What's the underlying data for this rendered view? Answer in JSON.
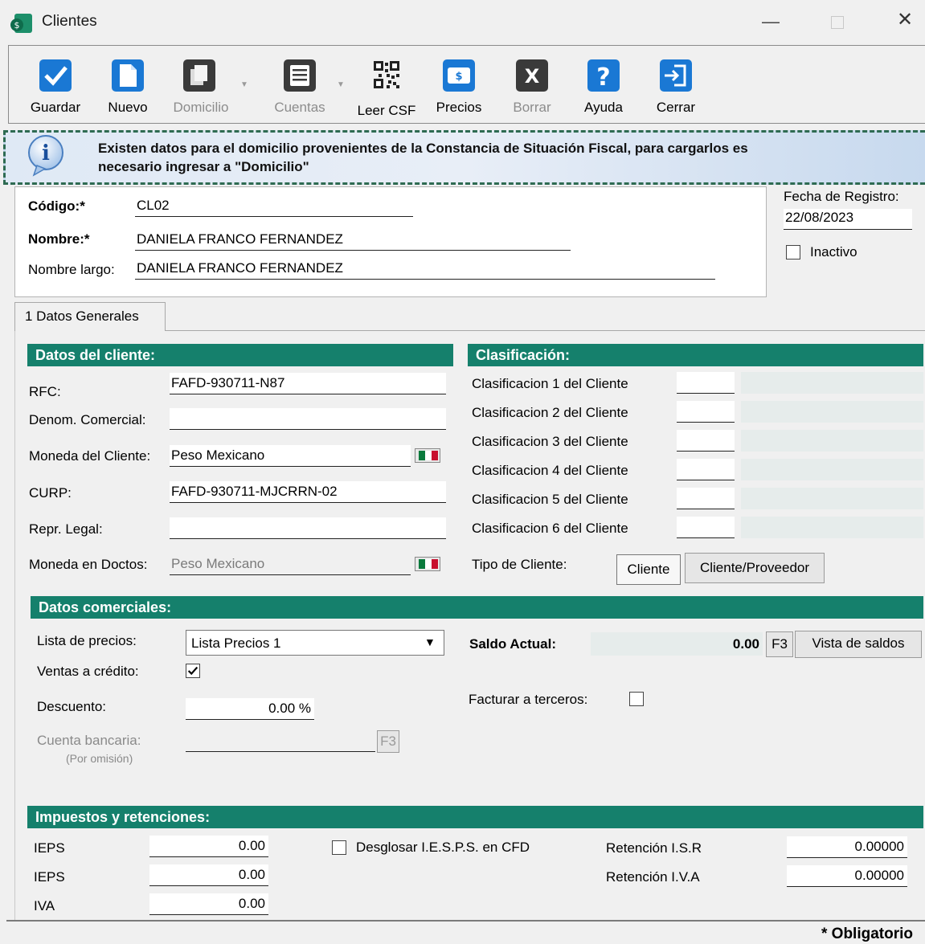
{
  "window": {
    "title": "Clientes"
  },
  "toolbar": {
    "guardar": "Guardar",
    "nuevo": "Nuevo",
    "domicilio": "Domicilio",
    "cuentas": "Cuentas",
    "leer_csf": "Leer CSF",
    "precios": "Precios",
    "borrar": "Borrar",
    "ayuda": "Ayuda",
    "cerrar": "Cerrar"
  },
  "info": {
    "line1": "Existen datos para el domicilio provenientes de la Constancia de Situación Fiscal, para cargarlos es",
    "line2": "necesario ingresar a \"Domicilio\""
  },
  "header": {
    "codigo_label": "Código:*",
    "codigo_value": "CL02",
    "nombre_label": "Nombre:*",
    "nombre_value": "DANIELA FRANCO FERNANDEZ",
    "nombre_largo_label": "Nombre largo:",
    "nombre_largo_value": "DANIELA FRANCO FERNANDEZ",
    "fecha_label": "Fecha de Registro:",
    "fecha_value": "22/08/2023",
    "inactivo_label": "Inactivo"
  },
  "tabs": [
    {
      "label": "1 Datos Generales"
    }
  ],
  "datos_cliente": {
    "title": "Datos del cliente:",
    "rfc_label": "RFC:",
    "rfc_value": "FAFD-930711-N87",
    "denom_label": "Denom. Comercial:",
    "denom_value": "",
    "moneda_label": "Moneda del Cliente:",
    "moneda_value": "Peso Mexicano",
    "curp_label": "CURP:",
    "curp_value": "FAFD-930711-MJCRRN-02",
    "repr_label": "Repr. Legal:",
    "repr_value": "",
    "moneda_doc_label": "Moneda en Doctos:",
    "moneda_doc_value": "Peso Mexicano"
  },
  "clasificacion": {
    "title": "Clasificación:",
    "items": [
      "Clasificacion 1 del Cliente",
      "Clasificacion 2 del Cliente",
      "Clasificacion 3 del Cliente",
      "Clasificacion 4 del Cliente",
      "Clasificacion 5 del Cliente",
      "Clasificacion 6 del Cliente"
    ],
    "tipo_label": "Tipo de Cliente:",
    "tipo_cliente": "Cliente",
    "tipo_cliente_proveedor": "Cliente/Proveedor"
  },
  "comerciales": {
    "title": "Datos comerciales:",
    "lista_label": "Lista de precios:",
    "lista_value": "Lista Precios 1",
    "ventas_label": "Ventas a crédito:",
    "descuento_label": "Descuento:",
    "descuento_value": "0.00 %",
    "cuenta_label": "Cuenta bancaria:",
    "cuenta_sub": "(Por omisión)",
    "f3": "F3",
    "saldo_label": "Saldo Actual:",
    "saldo_value": "0.00",
    "vista_saldos": "Vista de saldos",
    "facturar_label": "Facturar a terceros:"
  },
  "impuestos": {
    "title": "Impuestos y retenciones:",
    "ieps1_label": "IEPS",
    "ieps1_value": "0.00",
    "ieps2_label": "IEPS",
    "ieps2_value": "0.00",
    "iva_label": "IVA",
    "iva_value": "0.00",
    "desglosar_label": "Desglosar I.E.S.P.S. en CFD",
    "ret_isr_label": "Retención I.S.R",
    "ret_isr_value": "0.00000",
    "ret_iva_label": "Retención I.V.A",
    "ret_iva_value": "0.00000"
  },
  "footer": {
    "obligatorio": "* Obligatorio"
  }
}
